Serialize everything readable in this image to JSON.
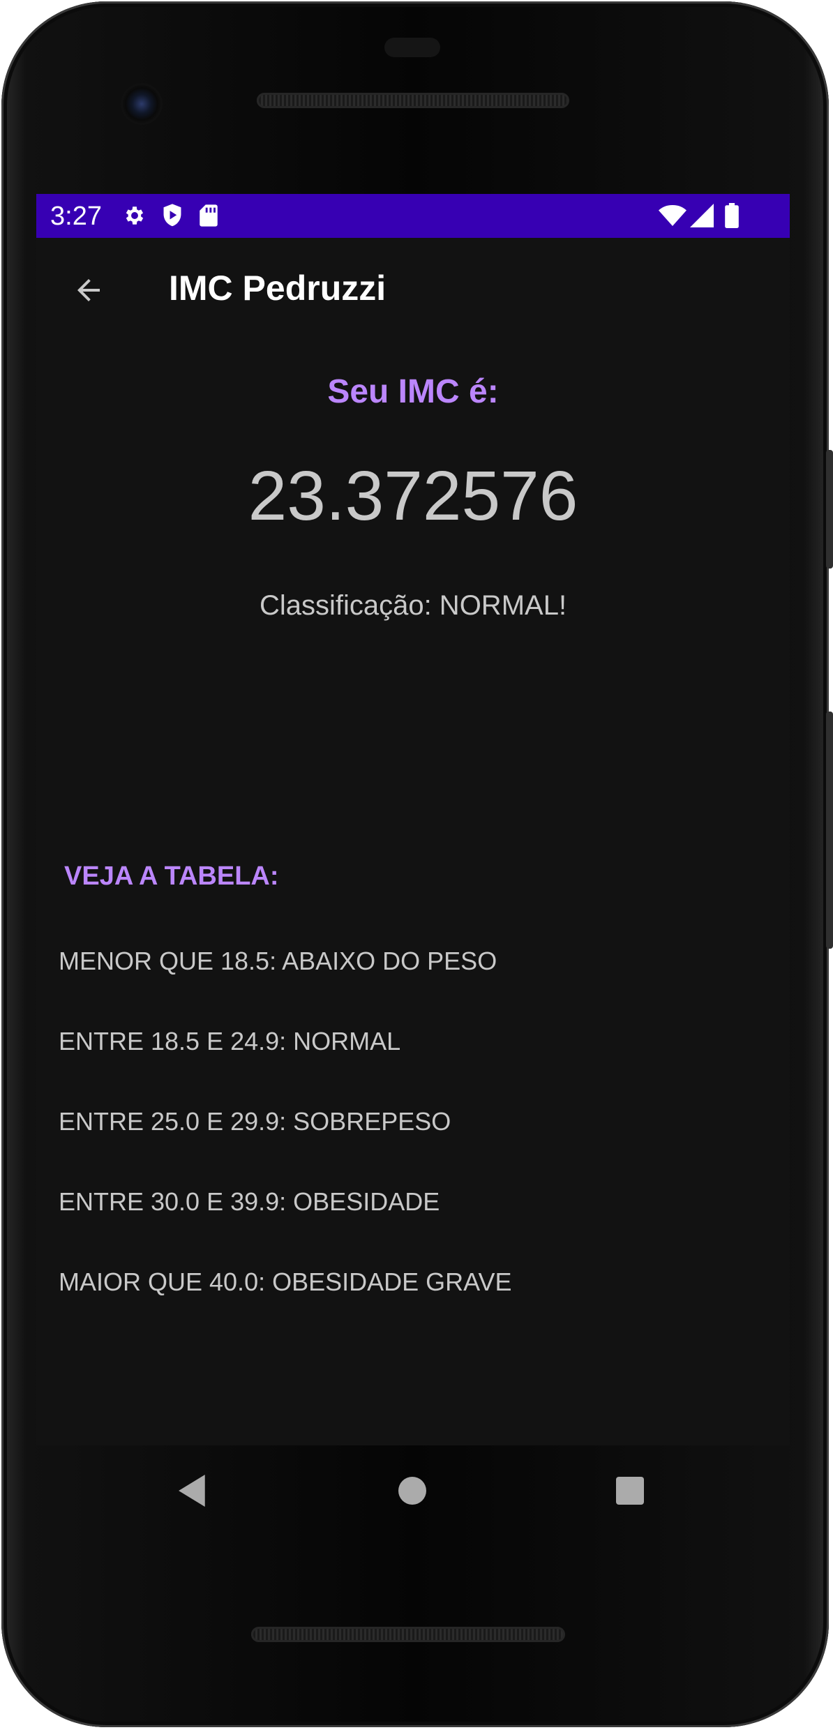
{
  "status_bar": {
    "time": "3:27",
    "left_icons": [
      "gear-icon",
      "shield-play-icon",
      "sd-card-icon"
    ],
    "right_icons": [
      "wifi-icon",
      "cell-signal-icon",
      "battery-icon"
    ],
    "background": "#3700b3"
  },
  "app_bar": {
    "title": "IMC Pedruzzi",
    "back_icon": "arrow-left-icon"
  },
  "result": {
    "label": "Seu IMC é:",
    "value": "23.372576",
    "classification": "Classificação: NORMAL!"
  },
  "table": {
    "title": "VEJA A TABELA:",
    "rows": [
      "MENOR QUE 18.5: ABAIXO DO PESO",
      "ENTRE 18.5 E 24.9: NORMAL",
      "ENTRE 25.0 E 29.9: SOBREPESO",
      "ENTRE 30.0 E 39.9: OBESIDADE",
      "MAIOR QUE 40.0: OBESIDADE GRAVE"
    ]
  },
  "nav_bar": {
    "buttons": [
      "back-triangle-icon",
      "home-circle-icon",
      "recents-square-icon"
    ]
  },
  "colors": {
    "accent": "#bb86fc",
    "screen_background": "#121212",
    "text": "#c9c9c9"
  }
}
